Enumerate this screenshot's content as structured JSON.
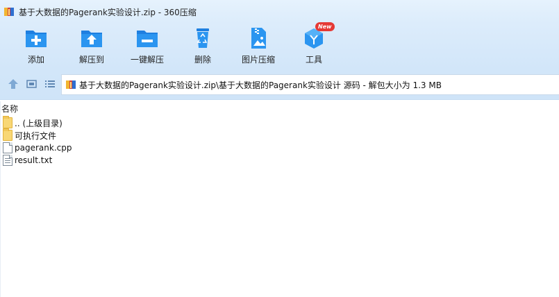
{
  "window": {
    "title": "基于大数据的Pagerank实验设计.zip - 360压缩"
  },
  "toolbar": {
    "add": "添加",
    "extract_to": "解压到",
    "one_click_extract": "一键解压",
    "delete": "删除",
    "image_compress": "图片压缩",
    "tools": "工具",
    "new_badge": "New"
  },
  "navbar": {
    "address": "基于大数据的Pagerank实验设计.zip\\基于大数据的Pagerank实验设计 源码 - 解包大小为 1.3 MB"
  },
  "list": {
    "column_name": "名称",
    "items": [
      {
        "name": ".. (上级目录)",
        "type": "folder"
      },
      {
        "name": "可执行文件",
        "type": "folder"
      },
      {
        "name": "pagerank.cpp",
        "type": "file"
      },
      {
        "name": "result.txt",
        "type": "text"
      }
    ]
  },
  "colors": {
    "accent": "#1e88e5",
    "toolbar_bg": "#d6e9fa",
    "badge": "#e53935"
  }
}
